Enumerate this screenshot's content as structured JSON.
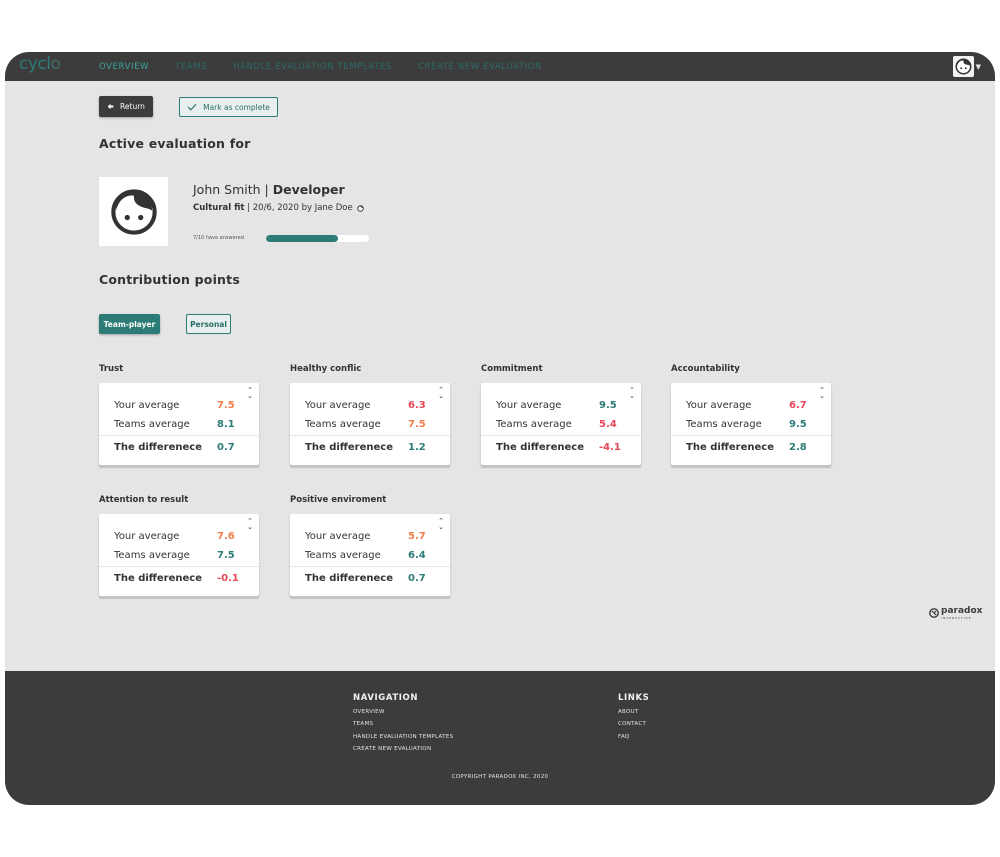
{
  "app": {
    "logo_main": "cycl",
    "logo_end": "o"
  },
  "nav": [
    {
      "label": "OVERVIEW",
      "active": true
    },
    {
      "label": "TEAMS",
      "active": false
    },
    {
      "label": "HANDLE EVALUATION TEMPLATES",
      "active": false
    },
    {
      "label": "CREATE NEW EVALUATION",
      "active": false
    }
  ],
  "actions": {
    "return_label": "Return",
    "complete_label": "Mark as complete"
  },
  "evaluation": {
    "section_title": "Active evaluation for",
    "name": "John Smith",
    "separator": " | ",
    "role": "Developer",
    "type": "Cultural fit",
    "meta": " | 20/6, 2020 by Jane Doe",
    "answered_text": "7/10 have answered",
    "progress": 0.7
  },
  "contribution": {
    "section_title": "Contribution points",
    "tabs": [
      "Team-player",
      "Personal"
    ]
  },
  "card_labels": {
    "your_average": "Your average",
    "teams_average": "Teams average",
    "difference": "The differenece"
  },
  "cards": [
    {
      "title": "Trust",
      "your": "7.5",
      "teams": "8.1",
      "diff": "0.7"
    },
    {
      "title": "Healthy conflic",
      "your": "6.3",
      "teams": "7.5",
      "diff": "1.2"
    },
    {
      "title": "Commitment",
      "your": "9.5",
      "teams": "5.4",
      "diff": "-4.1"
    },
    {
      "title": "Accountability",
      "your": "6.7",
      "teams": "9.5",
      "diff": "2.8"
    },
    {
      "title": "Attention to result",
      "your": "7.6",
      "teams": "7.5",
      "diff": "-0.1"
    },
    {
      "title": "Positive enviroment",
      "your": "5.7",
      "teams": "6.4",
      "diff": "0.7"
    }
  ],
  "brand": {
    "name": "paradox",
    "tagline": "INTERACTIVE"
  },
  "footer": {
    "nav_title": "NAVIGATION",
    "nav_links": [
      "OVERVIEW",
      "TEAMS",
      "HANDLE EVALUATION TEMPLATES",
      "CREATE NEW EVALUATION"
    ],
    "links_title": "LINKS",
    "links": [
      "ABOUT",
      "CONTACT",
      "FAQ"
    ],
    "copyright": "COPYRIGHT PARADOX INC, 2020"
  },
  "colors": {
    "teal": "#2b7c76",
    "orange": "#f07d4b",
    "red": "#e8465a",
    "dark": "#3c3c3c",
    "background": "#e5e5e5"
  }
}
